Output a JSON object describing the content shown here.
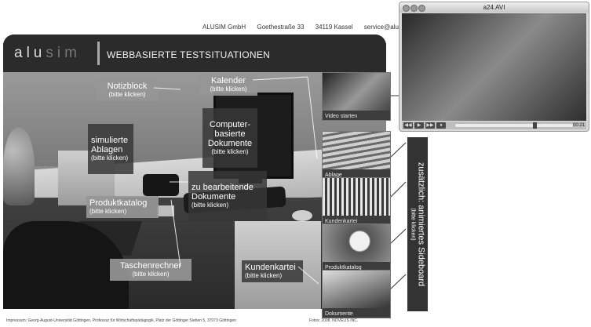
{
  "contact": {
    "company": "ALUSIM GmbH",
    "street": "Goethestraße 33",
    "city": "34119 Kassel",
    "email": "service@alusim.de"
  },
  "header": {
    "logo_bright": "alu",
    "logo_faint": "sim",
    "title": "WEBBASIERTE TESTSITUATIONEN"
  },
  "hotspots": {
    "notizblock": {
      "label": "Notizblock",
      "sub": "(bitte klicken)"
    },
    "kalender": {
      "label": "Kalender",
      "sub": "(bitte klicken)"
    },
    "computer": {
      "label": "Computer-\nbasierte\nDokumente",
      "sub": "(bitte klicken)"
    },
    "ablagen": {
      "label": "simulierte\nAblagen",
      "sub": "(bitte klicken)"
    },
    "bearbeitende": {
      "label": "zu bearbeitende\nDokumente",
      "sub": "(bitte klicken)"
    },
    "produktkatalog": {
      "label": "Produktkatalog",
      "sub": "(bitte klicken)"
    },
    "taschenrechner": {
      "label": "Taschenrechner",
      "sub": "(bitte klicken)"
    },
    "kundenkartei": {
      "label": "Kundenkartei",
      "sub": "(bitte klicken)"
    }
  },
  "thumbs": {
    "video": "Video starten",
    "ablage": "Ablage",
    "kundenkartei": "Kundenkartei",
    "produktkatalog": "Produktkatalog",
    "dokumente": "Dokumente"
  },
  "video_window": {
    "title": "a24.AVI",
    "time": "00:21",
    "progress_fraction": 0.68
  },
  "sideboard": {
    "main": "zusätzlich: animiertes Sideboard",
    "sub": "(bitte klicken)"
  },
  "footer": {
    "impressum": "Impressum: Georg-August-Universität Göttingen, Professur für Wirtschaftspädagogik, Platz der Göttinger Sieben 5, 37073 Göttingen",
    "fotos": "Fotos: 2008, NOVELIS INC."
  }
}
